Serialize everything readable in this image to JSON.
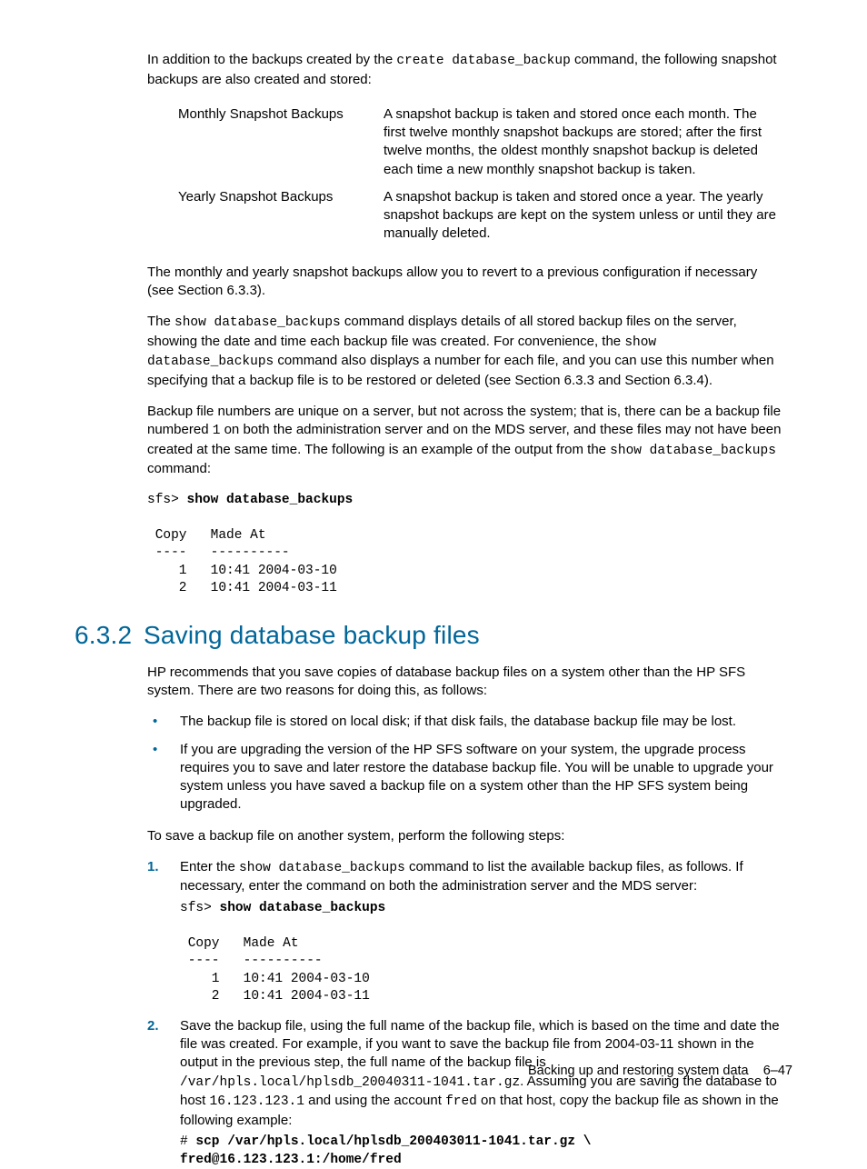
{
  "intro": {
    "p1_a": "In addition to the backups created by the ",
    "p1_cmd": "create database_backup",
    "p1_b": " command, the following snapshot backups are also created and stored:"
  },
  "defs": [
    {
      "term": "Monthly Snapshot Backups",
      "desc": "A snapshot backup is taken and stored once each month. The first twelve monthly snapshot backups are stored; after the first twelve months, the oldest monthly snapshot backup is deleted each time a new monthly snapshot backup is taken."
    },
    {
      "term": "Yearly Snapshot Backups",
      "desc": "A snapshot backup is taken and stored once a year. The yearly snapshot backups are kept on the system unless or until they are manually deleted."
    }
  ],
  "p2": "The monthly and yearly snapshot backups allow you to revert to a previous configuration if necessary (see Section 6.3.3).",
  "p3": {
    "a": "The ",
    "cmd1": "show database_backups",
    "b": " command displays details of all stored backup files on the server, showing the date and time each backup file was created. For convenience, the ",
    "cmd2": "show database_backups",
    "c": " command also displays a number for each file, and you can use this number when specifying that a backup file is to be restored or deleted (see Section 6.3.3 and Section 6.3.4)."
  },
  "p4": {
    "a": "Backup file numbers are unique on a server, but not across the system; that is, there can be a backup file numbered ",
    "one": "1",
    "b": " on both the administration server and on the MDS server, and these files may not have been created at the same time. The following is an example of the output from the ",
    "cmd": "show database_backups",
    "c": " command:"
  },
  "code1": {
    "prompt": "sfs> ",
    "cmd": "show database_backups",
    "body": "\n Copy   Made At\n ----   ----------\n    1   10:41 2004-03-10\n    2   10:41 2004-03-11"
  },
  "section": {
    "num": "6.3.2",
    "title": "Saving database backup files"
  },
  "sp1": "HP recommends that you save copies of database backup files on a system other than the HP SFS system. There are two reasons for doing this, as follows:",
  "bullets": [
    "The backup file is stored on local disk; if that disk fails, the database backup file may be lost.",
    "If you are upgrading the version of the HP SFS software on your system, the upgrade process requires you to save and later restore the database backup file. You will be unable to upgrade your system unless you have saved a backup file on a system other than the HP SFS system being upgraded."
  ],
  "sp2": "To save a backup file on another system, perform the following steps:",
  "step1": {
    "a": "Enter the ",
    "cmd": "show database_backups",
    "b": " command to list the available backup files, as follows. If necessary, enter the command on both the administration server and the MDS server:"
  },
  "code2": {
    "prompt": "sfs> ",
    "cmd": "show database_backups",
    "body": "\n Copy   Made At\n ----   ----------\n    1   10:41 2004-03-10\n    2   10:41 2004-03-11"
  },
  "step2": {
    "a": "Save the backup file, using the full name of the backup file, which is based on the time and date the file was created. For example, if you want to save the backup file from 2004-03-11 shown in the output in the previous step, the full name of the backup file is ",
    "path": "/var/hpls.local/hplsdb_20040311-1041.tar.gz",
    "b": ". Assuming you are saving the database to host ",
    "host": "16.123.123.1",
    "c": " and using the account ",
    "user": "fred",
    "d": " on that host, copy the backup file as shown in the following example:"
  },
  "code3": {
    "prompt": "# ",
    "line1": "scp /var/hpls.local/hplsdb_200403011-1041.tar.gz \\",
    "line2": "fred@16.123.123.1:/home/fred"
  },
  "footer": {
    "left": "Backing up and restoring system data",
    "right": "6–47"
  }
}
